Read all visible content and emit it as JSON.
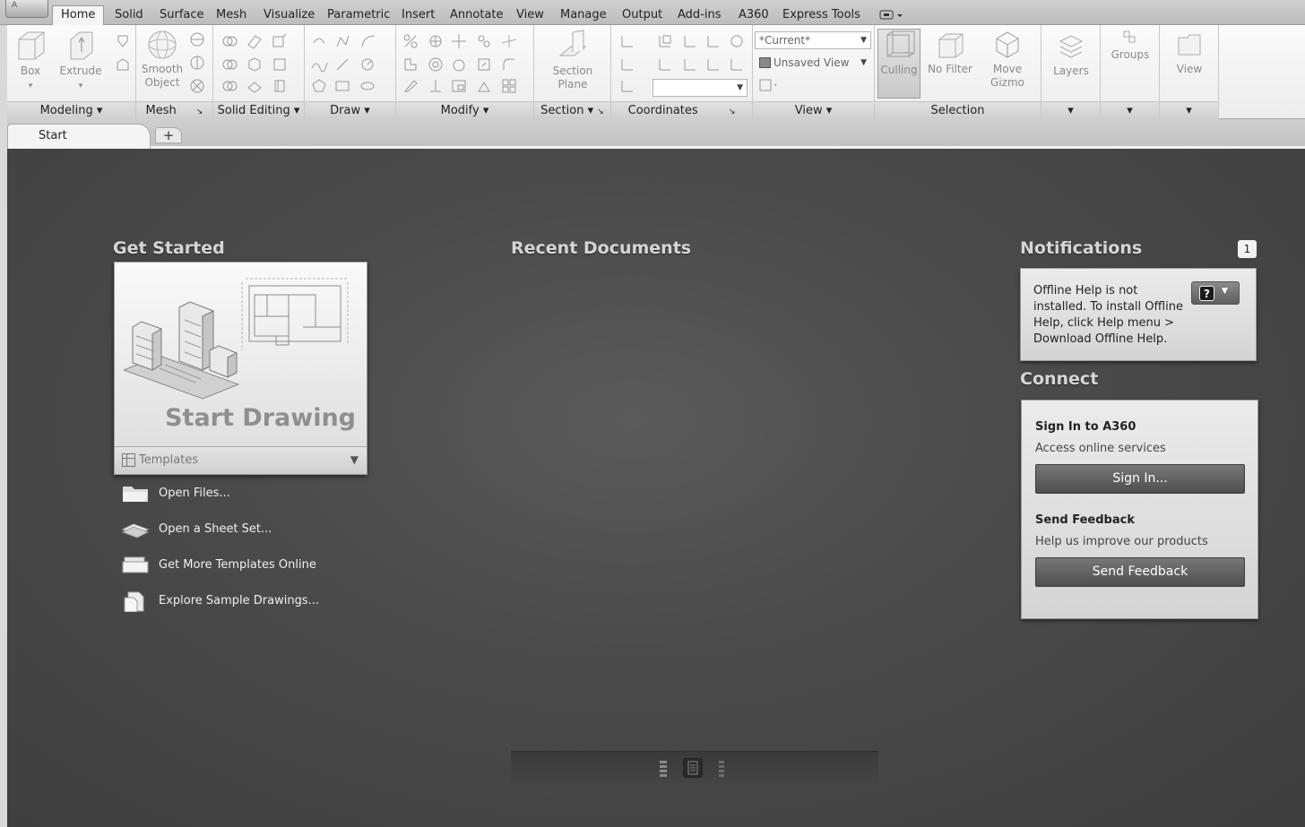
{
  "ribbon_tabs": [
    "Home",
    "Solid",
    "Surface",
    "Mesh",
    "Visualize",
    "Parametric",
    "Insert",
    "Annotate",
    "View",
    "Manage",
    "Output",
    "Add-ins",
    "A360",
    "Express Tools"
  ],
  "panels": {
    "modeling": {
      "title": "Modeling",
      "box_label": "Box",
      "extrude_label": "Extrude"
    },
    "mesh": {
      "title": "Mesh",
      "smooth_object_label": "Smooth Object"
    },
    "solid_editing": {
      "title": "Solid Editing"
    },
    "draw": {
      "title": "Draw"
    },
    "modify": {
      "title": "Modify"
    },
    "section": {
      "title": "Section",
      "section_plane_label": "Section Plane"
    },
    "coordinates": {
      "title": "Coordinates"
    },
    "view": {
      "title": "View",
      "visual_style_value": "*Current*",
      "named_view_value": "Unsaved View"
    },
    "selection": {
      "title": "Selection",
      "culling_label": "Culling",
      "no_filter_label": "No Filter",
      "move_gizmo_label": "Move Gizmo"
    },
    "layers": {
      "label": "Layers"
    },
    "groups": {
      "label": "Groups"
    },
    "view2": {
      "label": "View"
    }
  },
  "doc_tabs": {
    "start_label": "Start",
    "add_label": "+"
  },
  "get_started": {
    "title": "Get Started",
    "start_drawing_label": "Start Drawing",
    "templates_label": "Templates",
    "links": [
      {
        "label": "Open Files..."
      },
      {
        "label": "Open a Sheet Set..."
      },
      {
        "label": "Get More Templates Online"
      },
      {
        "label": "Explore Sample Drawings..."
      }
    ]
  },
  "recent_documents": {
    "title": "Recent Documents"
  },
  "notifications": {
    "title": "Notifications",
    "count": "1",
    "message": "Offline Help is not installed. To install Offline Help, click Help menu > Download Offline Help."
  },
  "connect": {
    "title": "Connect",
    "signin_title": "Sign In to A360",
    "signin_subtitle": "Access online services",
    "signin_button": "Sign In...",
    "feedback_title": "Send Feedback",
    "feedback_subtitle": "Help us improve our products",
    "feedback_button": "Send Feedback"
  },
  "colors": {
    "main_bg": "#474747",
    "ribbon_bg": "#f5f5f5",
    "button_dark": "#5e5e5e"
  }
}
